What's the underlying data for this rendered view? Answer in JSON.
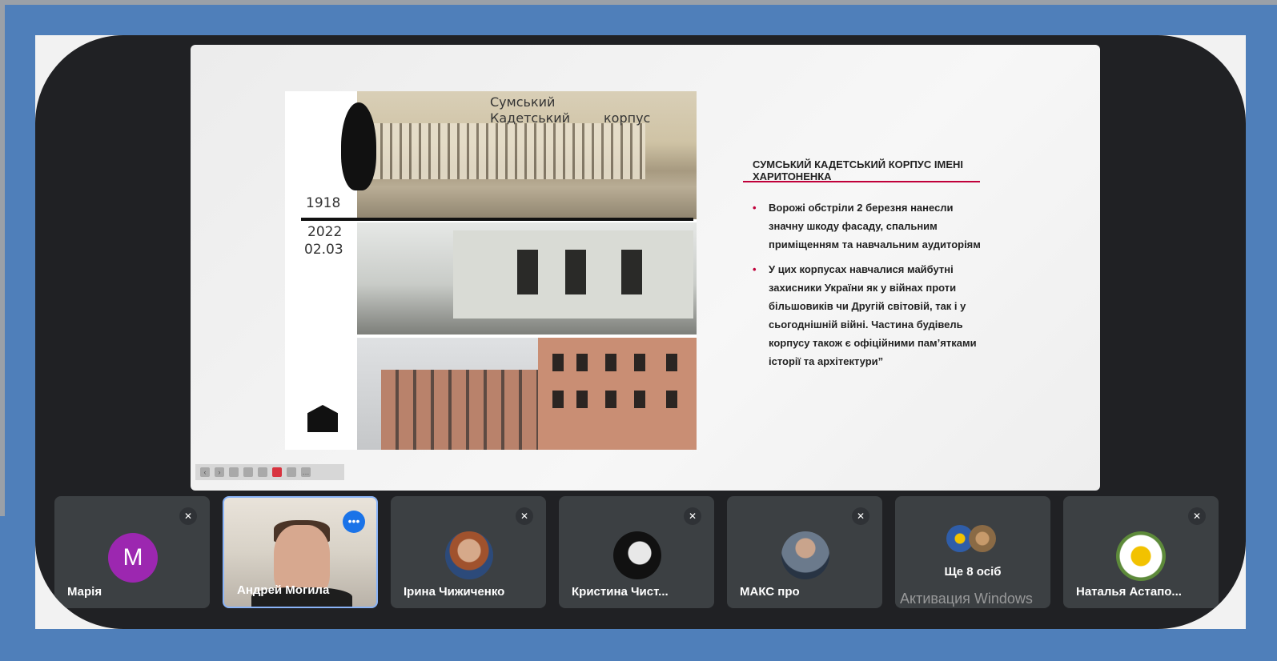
{
  "slide": {
    "handwriting": {
      "caption_top": "Сумський",
      "caption_mid": "Кадетський",
      "caption_right": "корпус",
      "year_1": "1918",
      "year_2": "2022",
      "date_2": "02.03"
    },
    "title": "СУМСЬКИЙ КАДЕТСЬКИЙ КОРПУС ІМЕНІ ХАРИТОНЕНКА",
    "bullets": [
      "Ворожі обстріли 2 березня нанесли значну шкоду фасаду, спальним приміщенням та навчальним аудиторіям",
      "У цих корпусах навчалися майбутні захисники України як у війнах проти більшовиків чи Другій світовій, так і у сьогоднішній війні. Частина будівель корпусу також є офіційними пам’ятками історії та архітектури”"
    ]
  },
  "participants": [
    {
      "name": "Марія",
      "avatar_letter": "M",
      "avatar_color": "#9c27b0",
      "muted": true
    },
    {
      "name": "Андрей Могила",
      "selected": true
    },
    {
      "name": "Ірина Чижиченко",
      "muted": true
    },
    {
      "name": "Кристина Чист...",
      "muted": true
    },
    {
      "name": "МАКС про",
      "muted": true
    },
    {
      "name": "Ще 8 осіб"
    },
    {
      "name": "Наталья Астапо...",
      "muted": true
    }
  ],
  "watermark": "Активация Windows",
  "colors": {
    "accent_red": "#c0003a",
    "meet_bg": "#202124",
    "tile_bg": "#3c4043",
    "frame_blue": "#4f7fba"
  }
}
